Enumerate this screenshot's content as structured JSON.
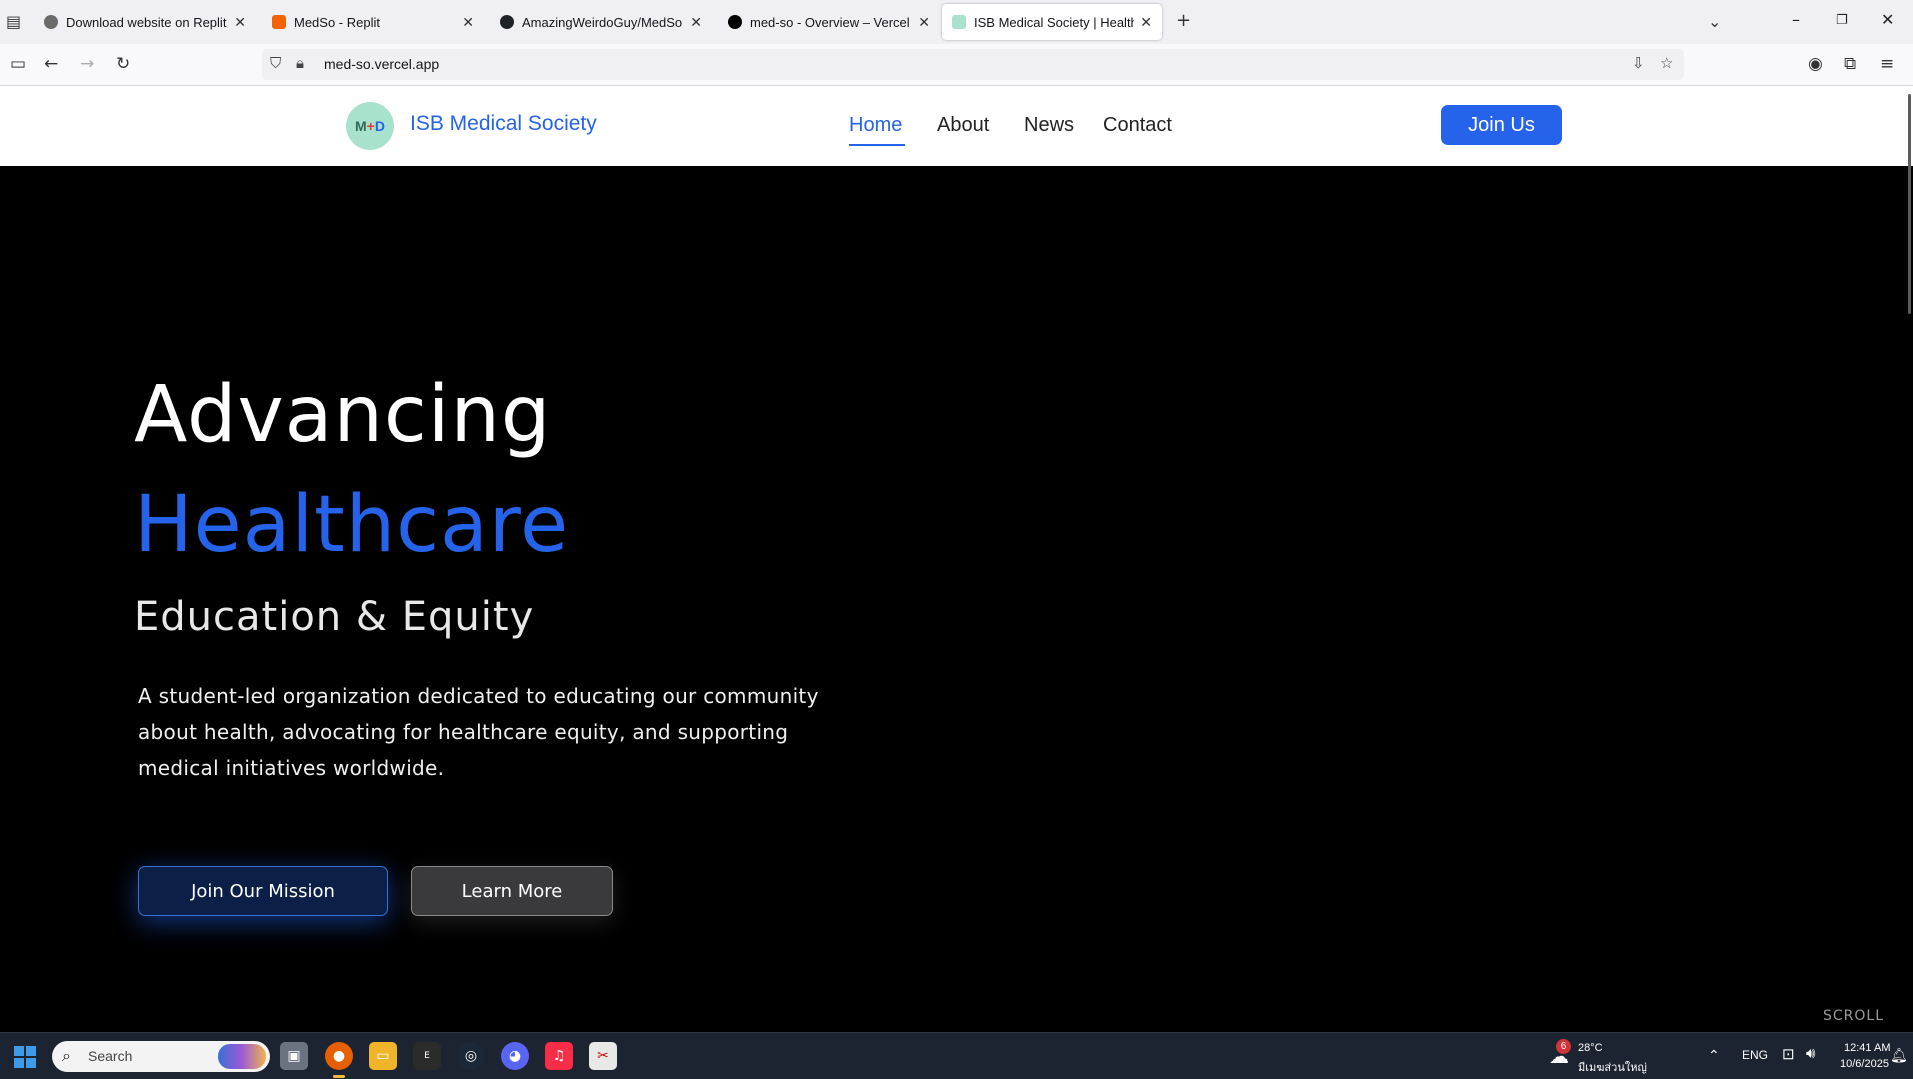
{
  "browser": {
    "tabs": [
      {
        "title": "Download website on Replit",
        "icon": "replit-ai-icon"
      },
      {
        "title": "MedSo - Replit",
        "icon": "replit-icon"
      },
      {
        "title": "AmazingWeirdoGuy/MedSo",
        "icon": "github-icon"
      },
      {
        "title": "med-so - Overview – Vercel",
        "icon": "vercel-icon"
      },
      {
        "title": "ISB Medical Society | Healthcare",
        "icon": "medso-favicon",
        "active": true
      }
    ],
    "url": "med-so.vercel.app"
  },
  "site": {
    "logo_text": {
      "m": "M",
      "plus": "+",
      "d": "D"
    },
    "brand": "ISB Medical Society",
    "nav": [
      "Home",
      "About",
      "News",
      "Contact"
    ],
    "active_nav": "Home",
    "join_label": "Join Us",
    "accent_color": "#2563eb"
  },
  "hero": {
    "line1": "Advancing",
    "line2": "Healthcare",
    "subtitle": "Education & Equity",
    "description": "A student-led organization dedicated to educating our community about health, advocating for healthcare equity, and supporting medical initiatives worldwide.",
    "primary_cta": "Join Our Mission",
    "secondary_cta": "Learn More",
    "scroll_hint": "SCROLL"
  },
  "taskbar": {
    "search_placeholder": "Search",
    "weather_badge": "6",
    "temperature": "28°C",
    "weather_text": "มีเมฆส่วนใหญ่",
    "language": "ENG",
    "time": "12:41 AM",
    "date": "10/6/2025"
  }
}
